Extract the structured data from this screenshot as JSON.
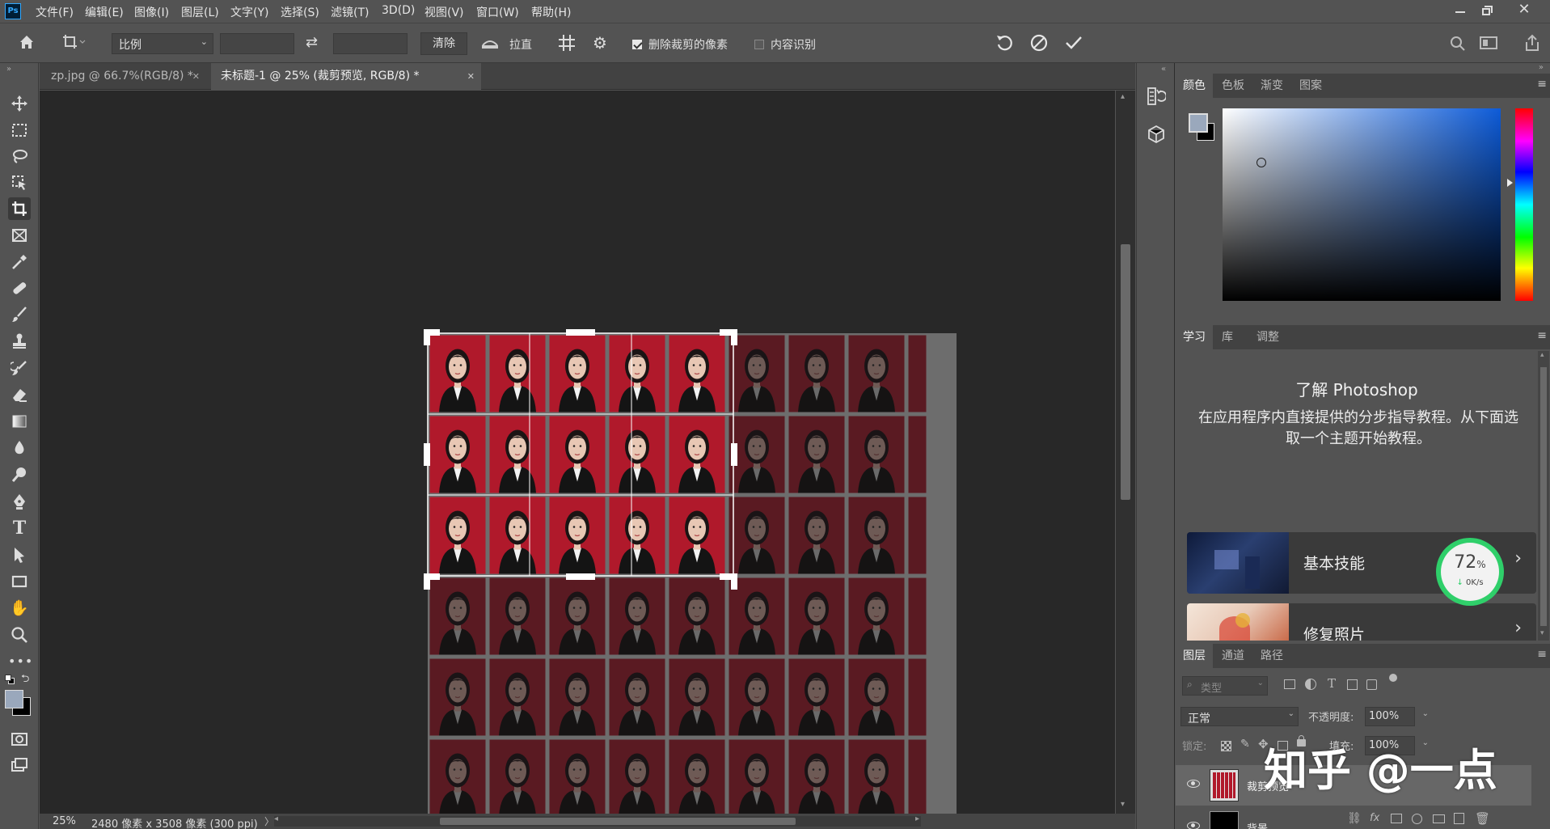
{
  "menu": {
    "logo": "Ps",
    "items": [
      "文件(F)",
      "编辑(E)",
      "图像(I)",
      "图层(L)",
      "文字(Y)",
      "选择(S)",
      "滤镜(T)",
      "3D(D)",
      "视图(V)",
      "窗口(W)",
      "帮助(H)"
    ]
  },
  "options": {
    "ratio_select": "比例",
    "clear_button": "清除",
    "straighten_label": "拉直",
    "delete_cropped_label": "删除裁剪的像素",
    "delete_cropped_checked": true,
    "content_aware_label": "内容识别",
    "content_aware_checked": false
  },
  "tabs": [
    {
      "label": "zp.jpg @ 66.7%(RGB/8) *",
      "active": false
    },
    {
      "label": "未标题-1 @ 25% (裁剪预览, RGB/8) *",
      "active": true
    }
  ],
  "canvas": {
    "grid_cols": 9,
    "grid_rows": 6,
    "crop_cols": 5,
    "crop_rows": 3,
    "photo_bg_color": "#b0192b",
    "dim_photo_bg_color": "#5a1a22"
  },
  "status": {
    "zoom": "25%",
    "doc_size": "2480 像素 x 3508 像素 (300 ppi)"
  },
  "color_panel": {
    "tabs": [
      "颜色",
      "色板",
      "渐变",
      "图案"
    ],
    "foreground": "#9aa8bc",
    "background": "#000000",
    "hue_color": "#0d5bd8"
  },
  "learn_panel": {
    "tabs": [
      "学习",
      "库",
      "调整"
    ],
    "title": "了解 Photoshop",
    "description": "在应用程序内直接提供的分步指导教程。从下面选取一个主题开始教程。",
    "cards": [
      {
        "label": "基本技能"
      },
      {
        "label": "修复照片"
      }
    ]
  },
  "network_widget": {
    "percent": "72",
    "percent_unit": "%",
    "speed": "0K/s",
    "value": 0.72
  },
  "layers_panel": {
    "tabs": [
      "图层",
      "通道",
      "路径"
    ],
    "search_placeholder": "类型",
    "blend_mode": "正常",
    "opacity_label": "不透明度:",
    "opacity_value": "100%",
    "lock_label": "锁定:",
    "fill_label": "填充:",
    "fill_value": "100%",
    "layers": [
      {
        "name": "裁剪预览",
        "selected": true
      },
      {
        "name": "背景",
        "selected": false
      }
    ]
  },
  "watermark": "知乎 @一点"
}
